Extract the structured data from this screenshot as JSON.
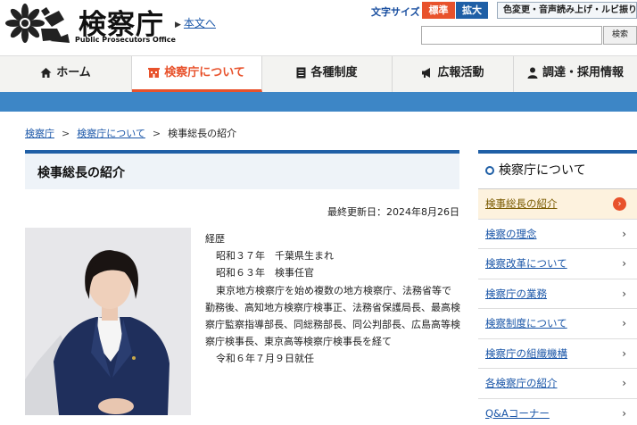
{
  "header": {
    "logo_title": "検察庁",
    "logo_subtitle": "Public Prosecutors Office",
    "skip_link": "本文へ",
    "font_size_label": "文字サイズ",
    "font_standard": "標準",
    "font_large": "拡大",
    "accessibility": "色変更・音声読み上げ・ルビ振り",
    "search_placeholder": "",
    "search_button": "検索"
  },
  "nav": [
    {
      "label": "ホーム",
      "icon": "home-icon"
    },
    {
      "label": "検察庁について",
      "icon": "building-icon",
      "active": true
    },
    {
      "label": "各種制度",
      "icon": "document-icon"
    },
    {
      "label": "広報活動",
      "icon": "megaphone-icon"
    },
    {
      "label": "調達・採用情報",
      "icon": "person-icon"
    }
  ],
  "breadcrumb": {
    "home": "検察庁",
    "parent": "検察庁について",
    "current": "検事総長の紹介",
    "sep": ">"
  },
  "main": {
    "title": "検事総長の紹介",
    "updated": "最終更新日：2024年8月26日",
    "bio_heading": "経歴",
    "bio_line1": "昭和３７年　千葉県生まれ",
    "bio_line2": "昭和６３年　検事任官",
    "bio_para": "東京地方検察庁を始め複数の地方検察庁、法務省等で勤務後、高知地方検察庁検事正、法務省保護局長、最高検察庁監察指導部長、同総務部長、同公判部長、広島高等検察庁検事長、東京高等検察庁検事長を経て",
    "bio_line_last": "令和６年７月９日就任"
  },
  "sidebar": {
    "heading": "検察庁について",
    "items": [
      {
        "label": "検事総長の紹介"
      },
      {
        "label": "検察の理念"
      },
      {
        "label": "検察改革について"
      },
      {
        "label": "検察庁の業務"
      },
      {
        "label": "検察制度について"
      },
      {
        "label": "検察庁の組織機構"
      },
      {
        "label": "各検察庁の紹介"
      },
      {
        "label": "Q&Aコーナー"
      }
    ],
    "chevron": "›"
  },
  "colors": {
    "accent_orange": "#e8522c",
    "brand_blue": "#1f5fa6",
    "band_blue": "#3d86c6"
  }
}
